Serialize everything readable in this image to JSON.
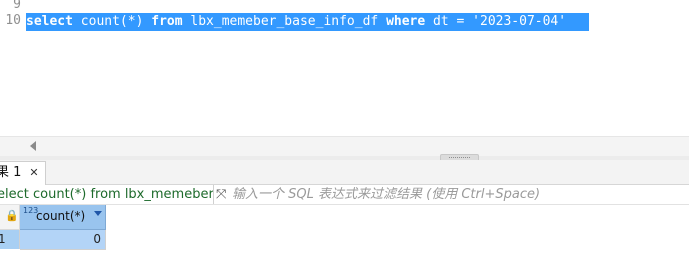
{
  "editor": {
    "line_numbers": [
      "9",
      "10"
    ],
    "sql": {
      "kw_select": "select",
      "fn_count": " count(*) ",
      "kw_from": "from",
      "table": " lbx_memeber_base_info_df ",
      "kw_where": "where",
      "condition": " dt = '2023-07-04'"
    }
  },
  "results": {
    "tab_label": "果 1",
    "close_glyph": "✕",
    "filter_query": "elect count(*) from lbx_memeber_base_info_df",
    "filter_placeholder": "输入一个 SQL 表达式来过滤结果 (使用 Ctrl+Space)",
    "expand_glyph": "⤧",
    "column": {
      "type_badge": "123",
      "name": "count(*)"
    },
    "rows": [
      {
        "row_num": "1",
        "value": "0"
      }
    ]
  },
  "colors": {
    "selection": "#3399ff",
    "column_header": "#99c4ee",
    "filter_query_text": "#1d6a2b"
  }
}
